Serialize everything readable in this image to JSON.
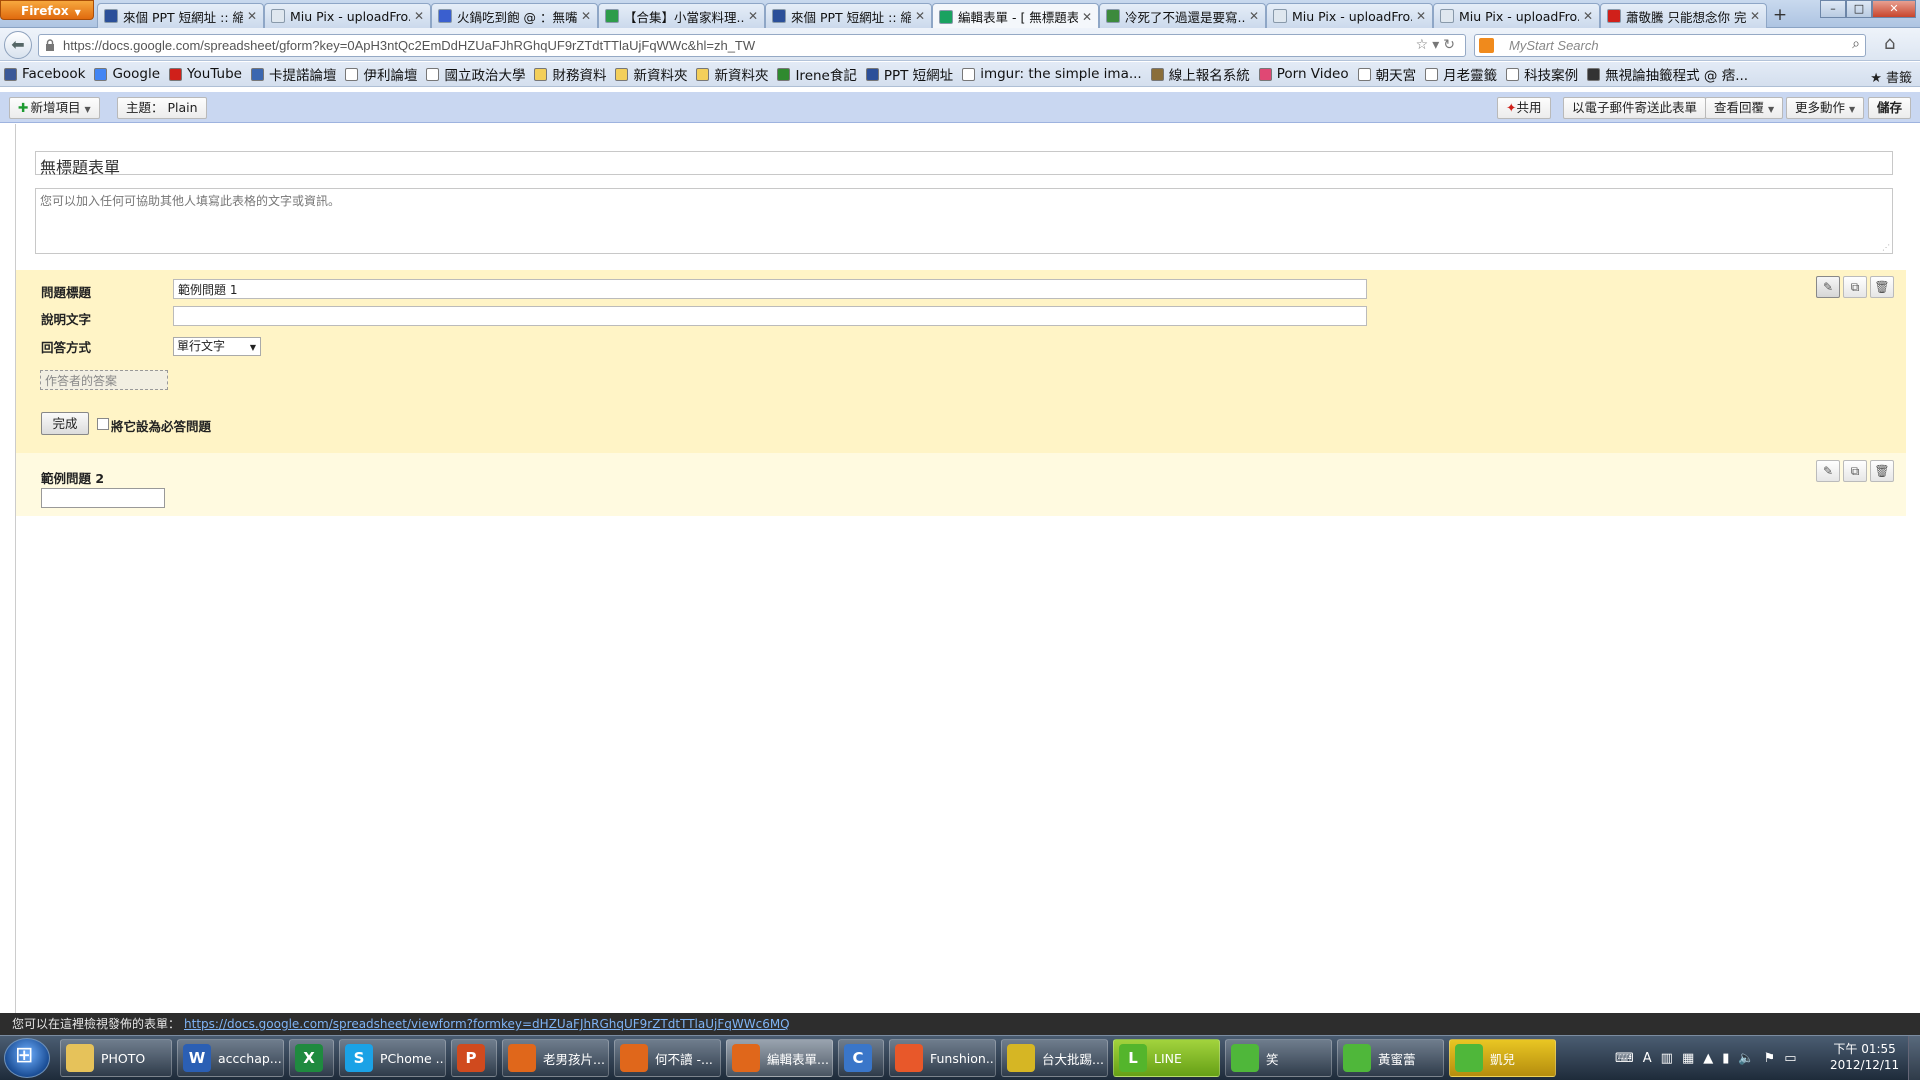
{
  "browser": {
    "menu_button": "Firefox",
    "tabs": [
      {
        "title": "來個 PPT 短網址 :: 縮...",
        "color": "#2b4f99"
      },
      {
        "title": "Miu Pix - uploadFro...",
        "color": "#dfe7ef"
      },
      {
        "title": "火鍋吃到飽 @ ：無嘴...",
        "color": "#3a5fcf"
      },
      {
        "title": "【合集】小當家料理...",
        "color": "#2d9c4a"
      },
      {
        "title": "來個 PPT 短網址 :: 縮...",
        "color": "#2b4f99"
      },
      {
        "title": "編輯表單 - [ 無標題表...",
        "color": "#1aa260",
        "active": true
      },
      {
        "title": "冷死了不過還是要寫...",
        "color": "#3c8a3c"
      },
      {
        "title": "Miu Pix - uploadFro...",
        "color": "#dfe7ef"
      },
      {
        "title": "Miu Pix - uploadFro...",
        "color": "#dfe7ef"
      },
      {
        "title": "蕭敬騰 只能想念你 完...",
        "color": "#d0201a"
      }
    ],
    "url": "https://docs.google.com/spreadsheet/gform?key=0ApH3ntQc2EmDdHZUaFJhRGhqUF9rZTdtTTlaUjFqWWc&hl=zh_TW",
    "search_placeholder": "MyStart Search",
    "bookmarks": [
      {
        "label": "Facebook",
        "color": "#3b5998"
      },
      {
        "label": "Google",
        "color": "#4285f4"
      },
      {
        "label": "YouTube",
        "color": "#d0201a"
      },
      {
        "label": "卡提諾論壇",
        "color": "#3b67b0"
      },
      {
        "label": "伊利論壇",
        "color": "#ffffff"
      },
      {
        "label": "國立政治大學",
        "color": "#ffffff"
      },
      {
        "label": "財務資料",
        "color": "#f3cf5a"
      },
      {
        "label": "新資料夾",
        "color": "#f3cf5a"
      },
      {
        "label": "新資料夾",
        "color": "#f3cf5a"
      },
      {
        "label": "Irene食記",
        "color": "#2f8a2f"
      },
      {
        "label": "PPT 短網址",
        "color": "#2b4f99"
      },
      {
        "label": "imgur: the simple ima...",
        "color": "#ffffff"
      },
      {
        "label": "線上報名系統",
        "color": "#8a6e3a"
      },
      {
        "label": "Porn Video",
        "color": "#e04874"
      },
      {
        "label": "朝天宮",
        "color": "#ffffff"
      },
      {
        "label": "月老靈籤",
        "color": "#ffffff"
      },
      {
        "label": "科技案例",
        "color": "#ffffff"
      },
      {
        "label": "無視論抽籤程式 @ 痞...",
        "color": "#333333"
      }
    ],
    "bookmarks_menu": "書籤"
  },
  "toolbar": {
    "new_item": "新增項目",
    "theme": "主題： Plain",
    "share": "共用",
    "email_form": "以電子郵件寄送此表單",
    "view_responses": "查看回覆",
    "more_actions": "更多動作",
    "save": "儲存"
  },
  "form": {
    "title": "無標題表單",
    "description": "您可以加入任何可協助其他人填寫此表格的文字或資訊。",
    "question1": {
      "title_label": "問題標題",
      "title_value": "範例問題 1",
      "help_label": "說明文字",
      "help_value": "",
      "type_label": "回答方式",
      "type_value": "單行文字",
      "answer_placeholder": "作答者的答案",
      "done": "完成",
      "required_label": "將它設為必答問題"
    },
    "question2": {
      "title": "範例問題 2"
    }
  },
  "status": {
    "text": "您可以在這裡檢視發佈的表單：",
    "link": "https://docs.google.com/spreadsheet/viewform?formkey=dHZUaFJhRGhqUF9rZTdtTTlaUjFqWWc6MQ"
  },
  "taskbar": {
    "items": [
      {
        "label": "PHOTO",
        "icon": "folder-icon",
        "color": "#e6c25a",
        "text": ""
      },
      {
        "label": "accchap...",
        "icon": "word-icon",
        "color": "#2b5fb4",
        "text": "W"
      },
      {
        "label": "",
        "icon": "excel-icon",
        "color": "#1f8a3f",
        "text": "X"
      },
      {
        "label": "PChome ...",
        "icon": "skype-icon",
        "color": "#1ba2e6",
        "text": "S"
      },
      {
        "label": "",
        "icon": "powerpoint-icon",
        "color": "#d04a1e",
        "text": "P"
      },
      {
        "label": "老男孩片...",
        "icon": "firefox-icon",
        "color": "#e0671b",
        "text": ""
      },
      {
        "label": "何不讀 -...",
        "icon": "firefox-icon",
        "color": "#e0671b",
        "text": ""
      },
      {
        "label": "編輯表單...",
        "icon": "firefox-icon",
        "color": "#e0671b",
        "text": ""
      },
      {
        "label": "",
        "icon": "app-c-icon",
        "color": "#3a76c9",
        "text": "C"
      },
      {
        "label": "Funshion...",
        "icon": "funshion-icon",
        "color": "#e8582a",
        "text": ""
      },
      {
        "label": "台大批踢...",
        "icon": "pcman-icon",
        "color": "#d6b624",
        "text": ""
      },
      {
        "label": "LINE",
        "icon": "line-icon",
        "color": "#54b52c",
        "text": "L"
      },
      {
        "label": "笑",
        "icon": "contact-icon",
        "color": "#4fb73a",
        "text": ""
      },
      {
        "label": "黃蜜蕾",
        "icon": "contact-icon",
        "color": "#4fb73a",
        "text": ""
      },
      {
        "label": "凱兒",
        "icon": "contact-icon",
        "color": "#4fb73a",
        "text": ""
      }
    ],
    "time": "下午 01:55",
    "date": "2012/12/11"
  }
}
